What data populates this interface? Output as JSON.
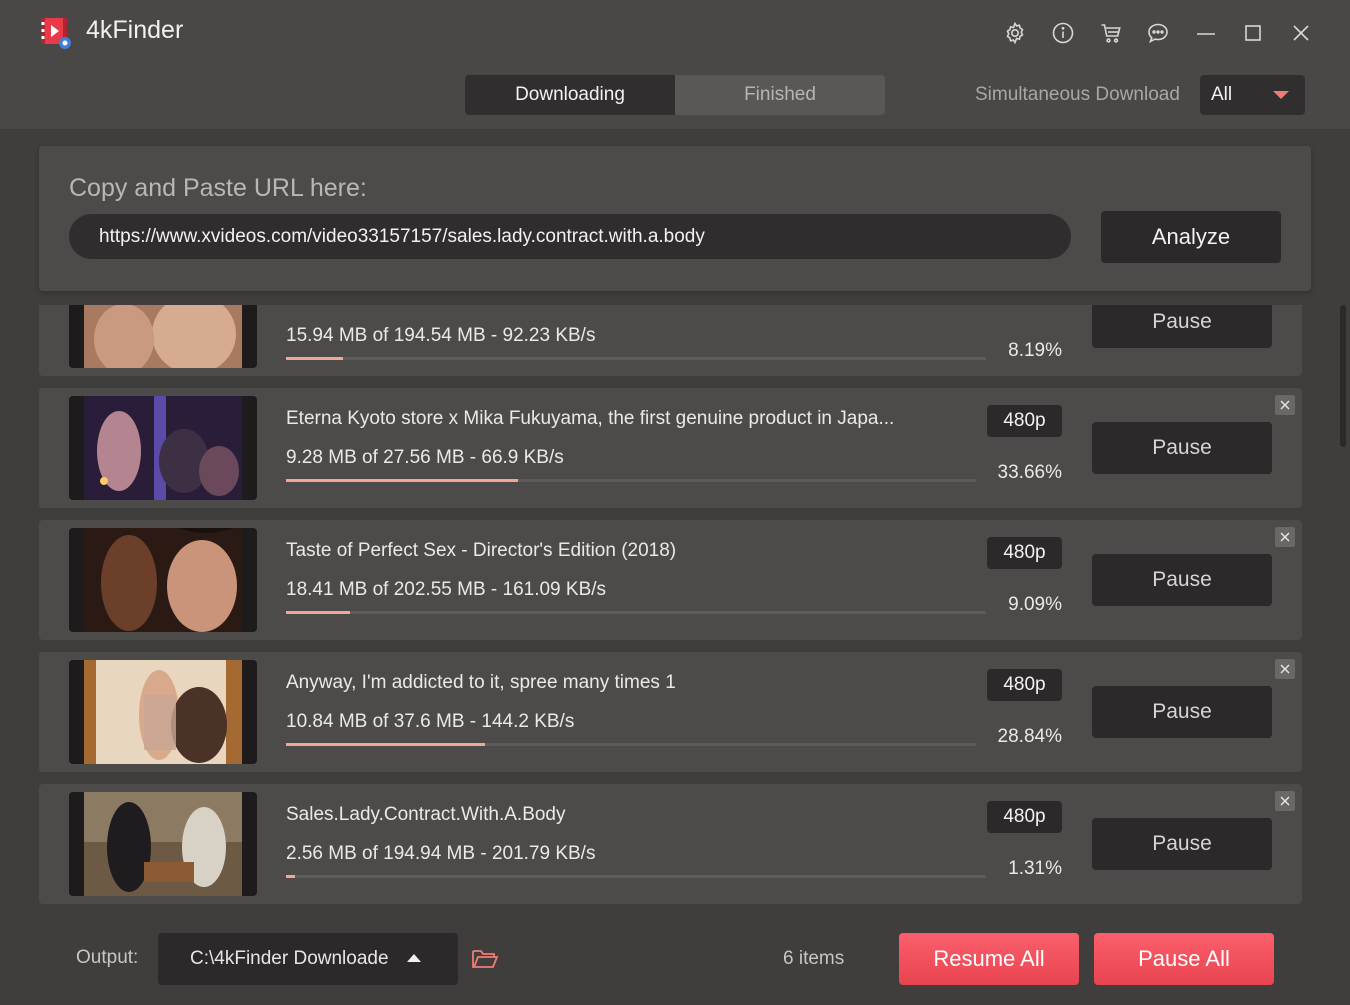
{
  "app": {
    "title": "4kFinder"
  },
  "tabs": [
    {
      "label": "Downloading",
      "active": true
    },
    {
      "label": "Finished",
      "active": false
    }
  ],
  "simultaneous": {
    "label": "Simultaneous Download",
    "value": "All"
  },
  "url_panel": {
    "label": "Copy and Paste URL here:",
    "value": "https://www.xvideos.com/video33157157/sales.lady.contract.with.a.body",
    "analyze_label": "Analyze"
  },
  "downloads": [
    {
      "title": "",
      "stats": "15.94 MB of 194.54 MB - 92.23 KB/s",
      "progress": "8.19%",
      "progress_value": 0.0819,
      "resolution": "",
      "pause_label": "Pause"
    },
    {
      "title": "Eterna Kyoto store x Mika Fukuyama, the first genuine product in Japa...",
      "stats": "9.28 MB of 27.56 MB - 66.9 KB/s",
      "progress": "33.66%",
      "progress_value": 0.3366,
      "resolution": "480p",
      "pause_label": "Pause"
    },
    {
      "title": "Taste of Perfect Sex - Director's Edition (2018)",
      "stats": "18.41 MB of 202.55 MB - 161.09 KB/s",
      "progress": "9.09%",
      "progress_value": 0.0909,
      "resolution": "480p",
      "pause_label": "Pause"
    },
    {
      "title": "Anyway, I'm addicted to it, spree many times 1",
      "stats": "10.84 MB of 37.6 MB - 144.2 KB/s",
      "progress": "28.84%",
      "progress_value": 0.2884,
      "resolution": "480p",
      "pause_label": "Pause"
    },
    {
      "title": "Sales.Lady.Contract.With.A.Body",
      "stats": "2.56 MB of 194.94 MB - 201.79 KB/s",
      "progress": "1.31%",
      "progress_value": 0.0131,
      "resolution": "480p",
      "pause_label": "Pause"
    }
  ],
  "footer": {
    "output_label": "Output:",
    "output_value": "C:\\4kFinder Downloade",
    "items_count": "6 items",
    "resume_all_label": "Resume All",
    "pause_all_label": "Pause All"
  },
  "icons": {
    "toolbar": [
      "gear-icon",
      "info-icon",
      "cart-icon",
      "chat-icon",
      "minimize-icon",
      "maximize-icon",
      "close-icon"
    ],
    "item_close": "close-icon",
    "folder": "folder-icon",
    "logo": "app-logo-icon"
  },
  "colors": {
    "accent_red": "#f25461",
    "progress": "#f1a697",
    "caret": "#f17c73"
  }
}
